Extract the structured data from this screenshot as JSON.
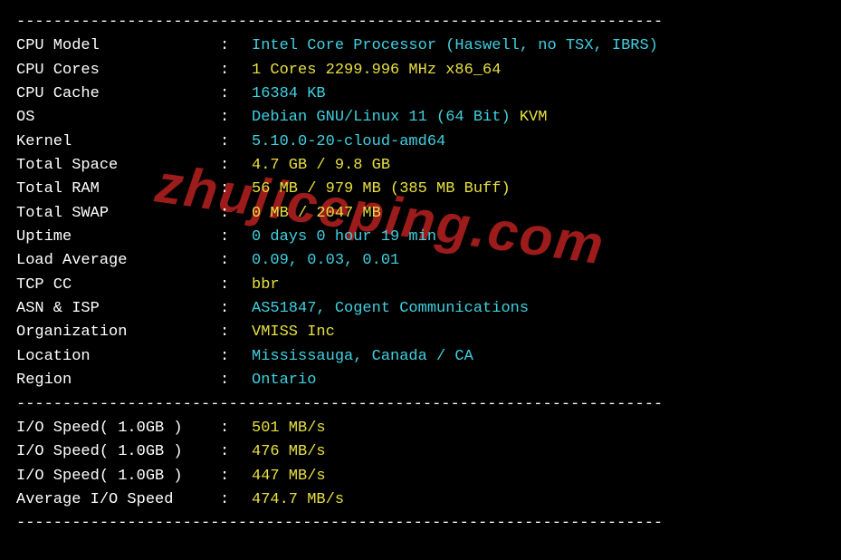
{
  "watermark": "zhujiceping.com",
  "divider": "----------------------------------------------------------------------",
  "sysinfo": [
    {
      "label": "CPU Model",
      "value_parts": [
        {
          "text": "Intel Core Processor (Haswell, no TSX, IBRS)",
          "cls": "cyan"
        }
      ]
    },
    {
      "label": "CPU Cores",
      "value_parts": [
        {
          "text": "1 Cores 2299.996 MHz x86_64",
          "cls": "yellow"
        }
      ]
    },
    {
      "label": "CPU Cache",
      "value_parts": [
        {
          "text": "16384 KB",
          "cls": "cyan"
        }
      ]
    },
    {
      "label": "OS",
      "value_parts": [
        {
          "text": "Debian GNU/Linux 11 (64 Bit) ",
          "cls": "cyan"
        },
        {
          "text": "KVM",
          "cls": "yellow"
        }
      ]
    },
    {
      "label": "Kernel",
      "value_parts": [
        {
          "text": "5.10.0-20-cloud-amd64",
          "cls": "cyan"
        }
      ]
    },
    {
      "label": "Total Space",
      "value_parts": [
        {
          "text": "4.7 GB / 9.8 GB",
          "cls": "yellow"
        }
      ]
    },
    {
      "label": "Total RAM",
      "value_parts": [
        {
          "text": "56 MB / 979 MB (385 MB Buff)",
          "cls": "yellow"
        }
      ]
    },
    {
      "label": "Total SWAP",
      "value_parts": [
        {
          "text": "0 MB / 2047 MB",
          "cls": "yellow"
        }
      ]
    },
    {
      "label": "Uptime",
      "value_parts": [
        {
          "text": "0 days 0 hour 19 min",
          "cls": "cyan"
        }
      ]
    },
    {
      "label": "Load Average",
      "value_parts": [
        {
          "text": "0.09, 0.03, 0.01",
          "cls": "cyan"
        }
      ]
    },
    {
      "label": "TCP CC",
      "value_parts": [
        {
          "text": "bbr",
          "cls": "yellow"
        }
      ]
    },
    {
      "label": "ASN & ISP",
      "value_parts": [
        {
          "text": "AS51847, Cogent Communications",
          "cls": "cyan"
        }
      ]
    },
    {
      "label": "Organization",
      "value_parts": [
        {
          "text": "VMISS Inc",
          "cls": "yellow"
        }
      ]
    },
    {
      "label": "Location",
      "value_parts": [
        {
          "text": "Mississauga, Canada / CA",
          "cls": "cyan"
        }
      ]
    },
    {
      "label": "Region",
      "value_parts": [
        {
          "text": "Ontario",
          "cls": "cyan"
        }
      ]
    }
  ],
  "iospeed": [
    {
      "label": "I/O Speed( 1.0GB )",
      "value_parts": [
        {
          "text": "501 MB/s",
          "cls": "yellow"
        }
      ]
    },
    {
      "label": "I/O Speed( 1.0GB )",
      "value_parts": [
        {
          "text": "476 MB/s",
          "cls": "yellow"
        }
      ]
    },
    {
      "label": "I/O Speed( 1.0GB )",
      "value_parts": [
        {
          "text": "447 MB/s",
          "cls": "yellow"
        }
      ]
    },
    {
      "label": "Average I/O Speed",
      "value_parts": [
        {
          "text": "474.7 MB/s",
          "cls": "yellow"
        }
      ]
    }
  ]
}
